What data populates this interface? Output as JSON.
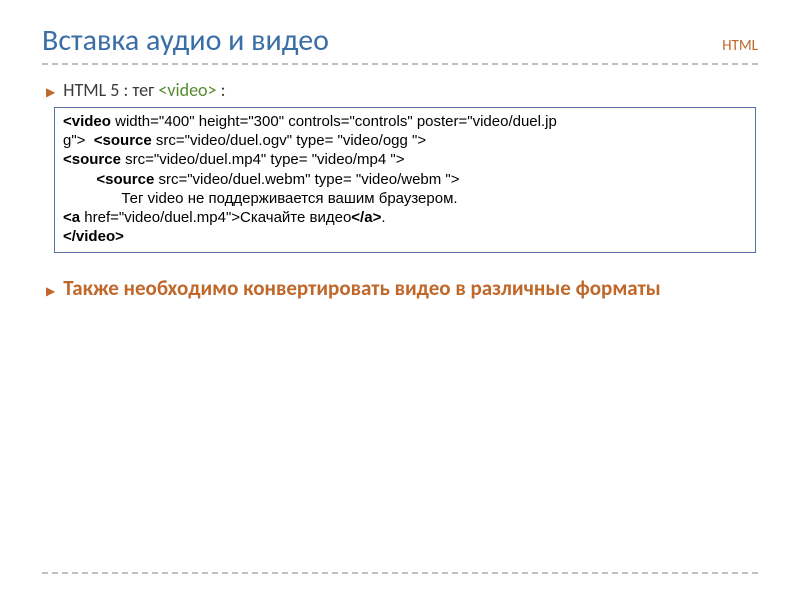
{
  "header": {
    "title": "Вставка аудио и видео",
    "badge": "HTML"
  },
  "bullet1": {
    "prefix": "HTML 5 : тег  ",
    "tag": "<video>",
    "suffix": " :"
  },
  "code": {
    "l1a": "<video",
    "l1b": " width=\"400\" height=\"300\" controls=\"controls\" poster=\"video/duel.jp",
    "l2a": "g\">",
    "l2b": "  <source",
    "l2c": " src=\"video/duel.ogv\" type= \"video/ogg \">",
    "l3a": "<source",
    "l3b": " src=\"video/duel.mp4\" type= \"video/mp4 \">",
    "l4a": "        <source",
    "l4b": " src=\"video/duel.webm\" type= \"video/webm \">",
    "l5": "              Тег video не поддерживается вашим браузером.",
    "l6a": "<a",
    "l6b": " href=\"video/duel.mp4\">Скачайте видео",
    "l6c": "</a>",
    "l6d": ".",
    "l7": "</video>"
  },
  "bullet2": "Также необходимо конвертировать видео в различные форматы"
}
